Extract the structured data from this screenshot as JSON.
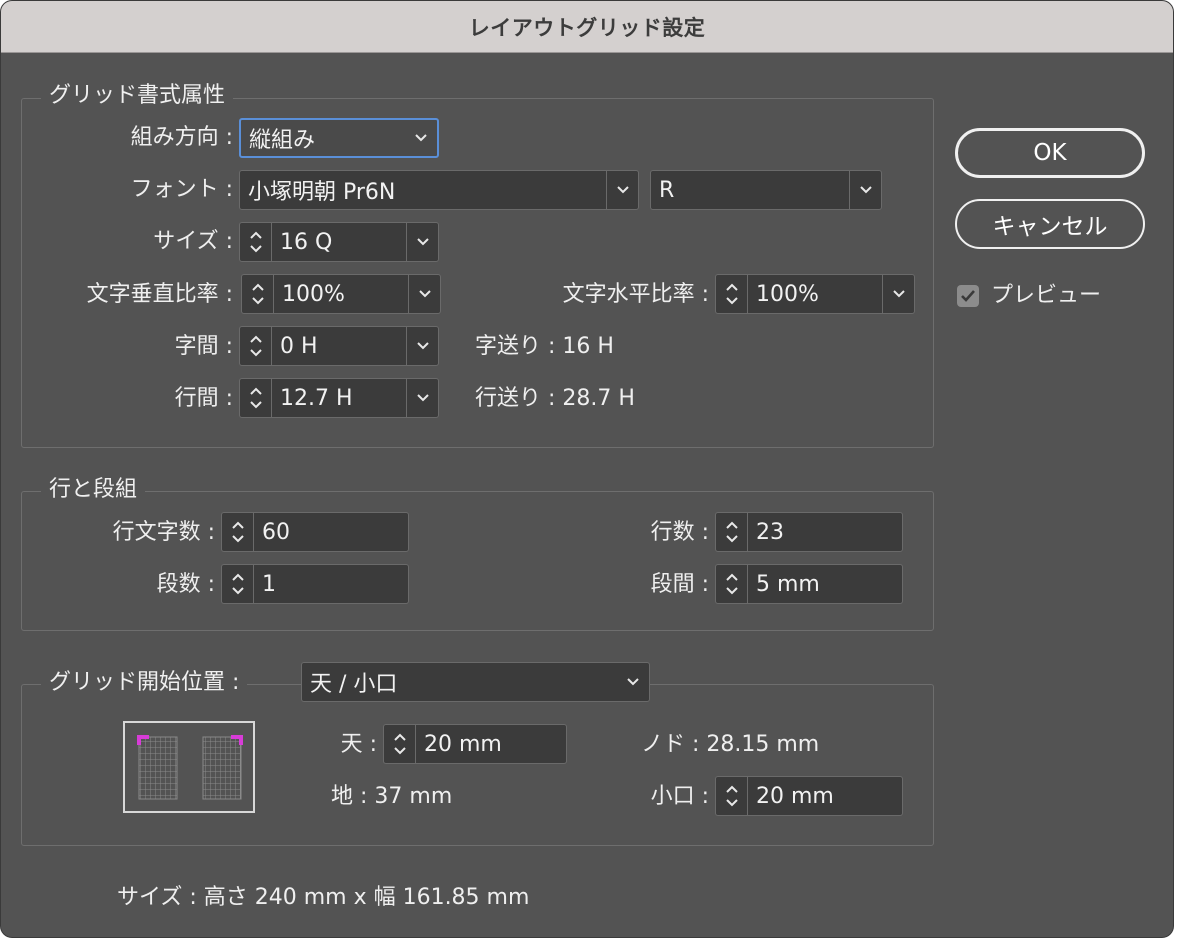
{
  "window": {
    "title": "レイアウトグリッド設定"
  },
  "grid_format": {
    "legend": "グリッド書式属性",
    "direction": {
      "label": "組み方向 :",
      "value": "縦組み"
    },
    "font": {
      "label": "フォント :",
      "family": "小塚明朝 Pr6N",
      "style": "R"
    },
    "size": {
      "label": "サイズ :",
      "value": "16 Q"
    },
    "vertical_scale": {
      "label": "文字垂直比率 :",
      "value": "100%"
    },
    "horizontal_scale": {
      "label": "文字水平比率 :",
      "value": "100%"
    },
    "char_spacing": {
      "label": "字間 :",
      "value": "0 H"
    },
    "char_advance": "字送り : 16 H",
    "line_spacing": {
      "label": "行間 :",
      "value": "12.7 H"
    },
    "line_advance": "行送り : 28.7 H"
  },
  "lines_columns": {
    "legend": "行と段組",
    "chars_per_line": {
      "label": "行文字数 :",
      "value": "60"
    },
    "lines": {
      "label": "行数 :",
      "value": "23"
    },
    "columns": {
      "label": "段数 :",
      "value": "1"
    },
    "gutter": {
      "label": "段間 :",
      "value": "5 mm"
    }
  },
  "grid_start": {
    "legend": "グリッド開始位置 :",
    "value": "天 / 小口",
    "top": {
      "label": "天 :",
      "value": "20 mm"
    },
    "inside": "ノド : 28.15 mm",
    "bottom": "地 : 37 mm",
    "outside": {
      "label": "小口 :",
      "value": "20 mm"
    }
  },
  "size_info": "サイズ : 高さ 240 mm x 幅 161.85 mm",
  "buttons": {
    "ok": "OK",
    "cancel": "キャンセル"
  },
  "preview": {
    "label": "プレビュー",
    "checked": true
  },
  "colors": {
    "accent": "#5a8fd8",
    "grid_marker": "#d83cd8"
  }
}
